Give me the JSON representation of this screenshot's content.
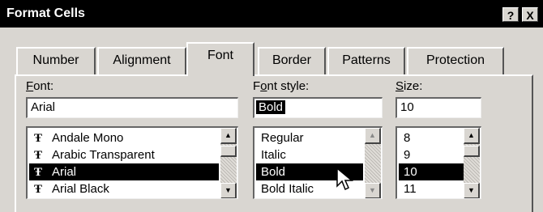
{
  "window": {
    "title": "Format Cells",
    "help_label": "?",
    "close_label": "X"
  },
  "tabs": [
    {
      "label": "Number"
    },
    {
      "label": "Alignment"
    },
    {
      "label": "Font"
    },
    {
      "label": "Border"
    },
    {
      "label": "Patterns"
    },
    {
      "label": "Protection"
    }
  ],
  "font": {
    "label_u": "F",
    "label_rest": "ont:",
    "value": "Arial",
    "items": [
      "Andale Mono",
      "Arabic Transparent",
      "Arial",
      "Arial Black"
    ],
    "selected_index": 2
  },
  "style": {
    "label_a": "F",
    "label_u": "o",
    "label_rest": "nt style:",
    "value": "Bold",
    "items": [
      "Regular",
      "Italic",
      "Bold",
      "Bold Italic"
    ],
    "selected_index": 2
  },
  "size": {
    "label_u": "S",
    "label_rest": "ize:",
    "value": "10",
    "items": [
      "8",
      "9",
      "10",
      "11"
    ],
    "selected_index": 2
  },
  "icons": {
    "truetype": "truetype-icon",
    "scroll_up": "arrow-up-icon",
    "scroll_down": "arrow-down-icon",
    "cursor": "mouse-pointer-icon"
  }
}
